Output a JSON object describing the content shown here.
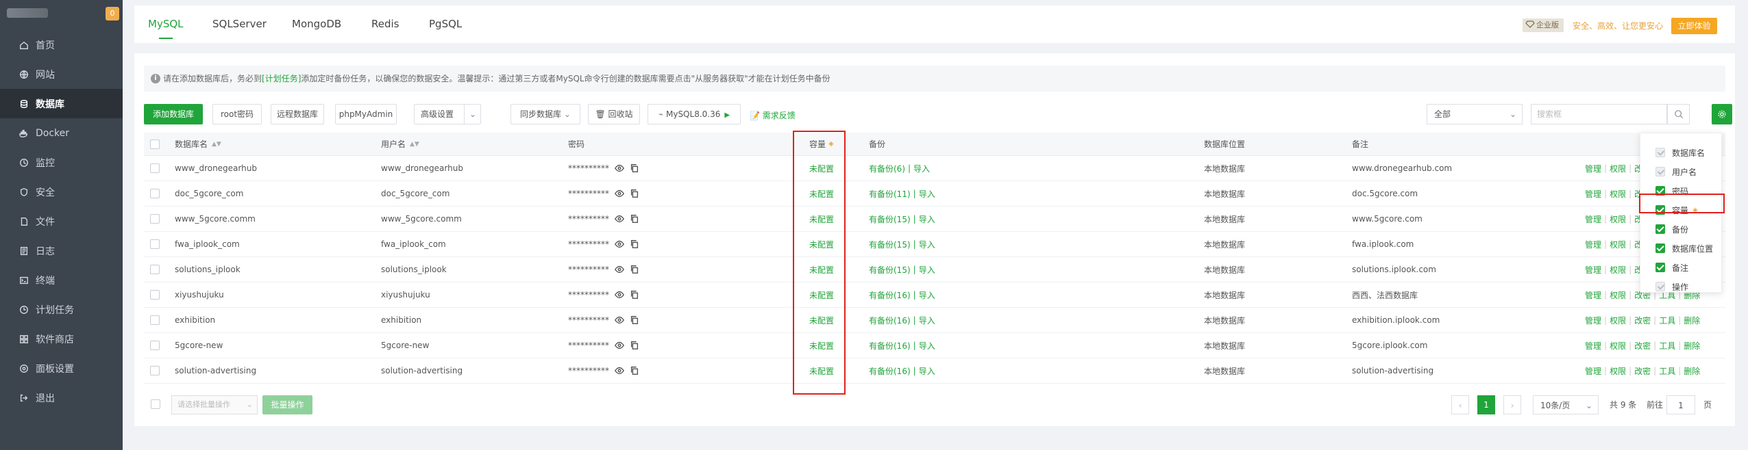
{
  "sidebar": {
    "badge": "0",
    "items": [
      {
        "label": "首页",
        "icon": "home-icon"
      },
      {
        "label": "网站",
        "icon": "globe-icon"
      },
      {
        "label": "数据库",
        "icon": "database-icon",
        "active": true
      },
      {
        "label": "Docker",
        "icon": "docker-icon"
      },
      {
        "label": "监控",
        "icon": "monitor-icon"
      },
      {
        "label": "安全",
        "icon": "shield-icon"
      },
      {
        "label": "文件",
        "icon": "file-icon"
      },
      {
        "label": "日志",
        "icon": "log-icon"
      },
      {
        "label": "终端",
        "icon": "terminal-icon"
      },
      {
        "label": "计划任务",
        "icon": "clock-icon"
      },
      {
        "label": "软件商店",
        "icon": "grid-icon"
      },
      {
        "label": "面板设置",
        "icon": "settings-icon"
      },
      {
        "label": "退出",
        "icon": "logout-icon"
      }
    ]
  },
  "tabs": [
    "MySQL",
    "SQLServer",
    "MongoDB",
    "Redis",
    "PgSQL"
  ],
  "header": {
    "enterprise_badge": "企业版",
    "enterprise_text": "安全、高效、让您更安心",
    "try_button": "立即体验"
  },
  "notice": {
    "part1": "请在添加数据库后，务必到",
    "link": "[计划任务]",
    "part2": "添加定时备份任务，以确保您的数据安全。温馨提示：通过第三方或者MySQL命令行创建的数据库需要点击\"从服务器获取\"才能在计划任务中备份"
  },
  "toolbar": {
    "add_db": "添加数据库",
    "root_pwd": "root密码",
    "remote_db": "远程数据库",
    "phpmyadmin": "phpMyAdmin",
    "advanced": "高级设置",
    "sync_db": "同步数据库",
    "recycle": "回收站",
    "mysql_version": "MySQL8.0.36",
    "feedback": "需求反馈",
    "filter_all": "全部",
    "search_placeholder": "搜索框"
  },
  "table": {
    "headers": {
      "name": "数据库名",
      "user": "用户名",
      "password": "密码",
      "capacity": "容量",
      "backup": "备份",
      "location": "数据库位置",
      "remark": "备注"
    },
    "rows": [
      {
        "name": "www_dronegearhub",
        "user": "www_dronegearhub",
        "pwd": "**********",
        "cap": "未配置",
        "backup": "有备份(6)",
        "import": "导入",
        "loc": "本地数据库",
        "remark": "www.dronegearhub.com"
      },
      {
        "name": "doc_5gcore_com",
        "user": "doc_5gcore_com",
        "pwd": "**********",
        "cap": "未配置",
        "backup": "有备份(11)",
        "import": "导入",
        "loc": "本地数据库",
        "remark": "doc.5gcore.com"
      },
      {
        "name": "www_5gcore.comm",
        "user": "www_5gcore.comm",
        "pwd": "**********",
        "cap": "未配置",
        "backup": "有备份(15)",
        "import": "导入",
        "loc": "本地数据库",
        "remark": "www.5gcore.com"
      },
      {
        "name": "fwa_iplook_com",
        "user": "fwa_iplook_com",
        "pwd": "**********",
        "cap": "未配置",
        "backup": "有备份(15)",
        "import": "导入",
        "loc": "本地数据库",
        "remark": "fwa.iplook.com"
      },
      {
        "name": "solutions_iplook",
        "user": "solutions_iplook",
        "pwd": "**********",
        "cap": "未配置",
        "backup": "有备份(15)",
        "import": "导入",
        "loc": "本地数据库",
        "remark": "solutions.iplook.com"
      },
      {
        "name": "xiyushujuku",
        "user": "xiyushujuku",
        "pwd": "**********",
        "cap": "未配置",
        "backup": "有备份(16)",
        "import": "导入",
        "loc": "本地数据库",
        "remark": "西西、法西数据库"
      },
      {
        "name": "exhibition",
        "user": "exhibition",
        "pwd": "**********",
        "cap": "未配置",
        "backup": "有备份(16)",
        "import": "导入",
        "loc": "本地数据库",
        "remark": "exhibition.iplook.com"
      },
      {
        "name": "5gcore-new",
        "user": "5gcore-new",
        "pwd": "**********",
        "cap": "未配置",
        "backup": "有备份(16)",
        "import": "导入",
        "loc": "本地数据库",
        "remark": "5gcore.iplook.com"
      },
      {
        "name": "solution-advertising",
        "user": "solution-advertising",
        "pwd": "**********",
        "cap": "未配置",
        "backup": "有备份(16)",
        "import": "导入",
        "loc": "本地数据库",
        "remark": "solution-advertising"
      }
    ],
    "ops": [
      "管理",
      "权限",
      "改密",
      "工具",
      "删除"
    ]
  },
  "column_menu": [
    {
      "label": "数据库名",
      "state": "disabled"
    },
    {
      "label": "用户名",
      "state": "disabled"
    },
    {
      "label": "密码",
      "state": "on"
    },
    {
      "label": "容量",
      "state": "on",
      "premium": true
    },
    {
      "label": "备份",
      "state": "on"
    },
    {
      "label": "数据库位置",
      "state": "on"
    },
    {
      "label": "备注",
      "state": "on"
    },
    {
      "label": "操作",
      "state": "disabled"
    }
  ],
  "footer": {
    "batch_placeholder": "请选择批量操作",
    "batch_button": "批量操作",
    "current_page": "1",
    "page_size": "10条/页",
    "total": "共 9 条",
    "goto": "前往",
    "goto_page": "1",
    "page_unit": "页"
  },
  "colors": {
    "accent": "#20a53a",
    "highlight_box": "#e0201b",
    "sidebar_bg": "#3c444d"
  }
}
